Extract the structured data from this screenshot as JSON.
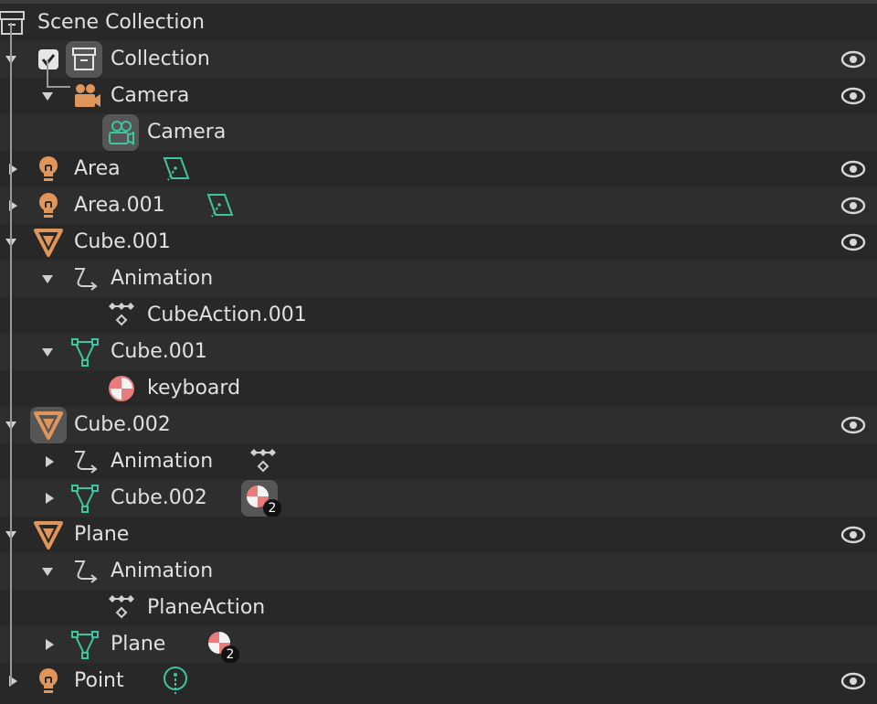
{
  "outliner": {
    "scene_collection_label": "Scene Collection",
    "rows": [
      {
        "label": "Collection"
      },
      {
        "label": "Camera"
      },
      {
        "label": "Camera"
      },
      {
        "label": "Area"
      },
      {
        "label": "Area.001"
      },
      {
        "label": "Cube.001"
      },
      {
        "label": "Animation"
      },
      {
        "label": "CubeAction.001"
      },
      {
        "label": "Cube.001"
      },
      {
        "label": "keyboard"
      },
      {
        "label": "Cube.002"
      },
      {
        "label": "Animation"
      },
      {
        "label": "Cube.002",
        "material_count": "2"
      },
      {
        "label": "Plane"
      },
      {
        "label": "Animation"
      },
      {
        "label": "PlaneAction"
      },
      {
        "label": "Plane",
        "material_count": "2"
      },
      {
        "label": "Point"
      }
    ]
  },
  "colors": {
    "object_orange": "#e0955a",
    "data_teal": "#3cc5a0",
    "material_red": "#e87b7b",
    "eye_gray": "#d8d8d8"
  },
  "icons": {
    "collection": "collection-icon",
    "camera_object": "camera-object-icon",
    "camera_data": "camera-data-icon",
    "light_object": "light-object-icon",
    "area_light_data": "area-light-data-icon",
    "point_light_data": "point-light-data-icon",
    "mesh_object": "mesh-object-icon",
    "mesh_data": "mesh-data-icon",
    "animation": "animation-icon",
    "action": "action-icon",
    "material": "material-icon",
    "visibility": "eye-icon"
  }
}
